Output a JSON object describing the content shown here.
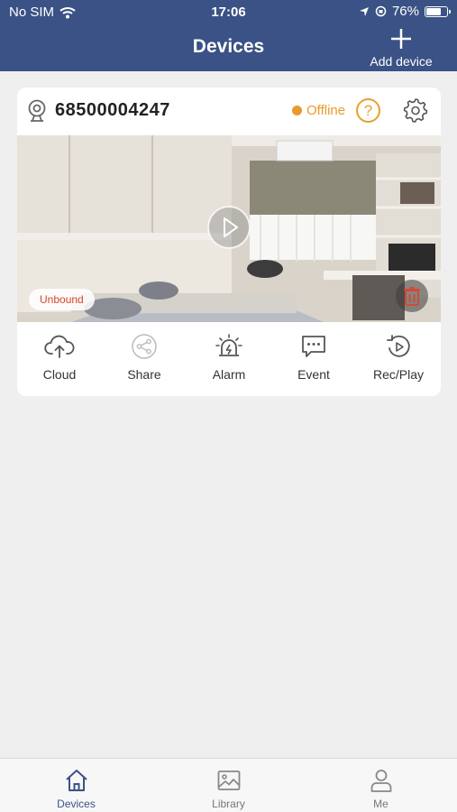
{
  "status_bar": {
    "carrier": "No SIM",
    "time": "17:06",
    "battery": "76%",
    "battery_level": 0.76
  },
  "header": {
    "title": "Devices",
    "add_label": "Add device"
  },
  "device": {
    "id": "68500004247",
    "status": "Offline",
    "help_glyph": "?",
    "badge": "Unbound",
    "actions": [
      {
        "label": "Cloud",
        "icon": "cloud-upload-icon"
      },
      {
        "label": "Share",
        "icon": "share-icon"
      },
      {
        "label": "Alarm",
        "icon": "alarm-icon"
      },
      {
        "label": "Event",
        "icon": "event-icon"
      },
      {
        "label": "Rec/Play",
        "icon": "playback-icon"
      }
    ]
  },
  "tabs": [
    {
      "label": "Devices",
      "icon": "home-icon",
      "active": true
    },
    {
      "label": "Library",
      "icon": "image-icon",
      "active": false
    },
    {
      "label": "Me",
      "icon": "user-icon",
      "active": false
    }
  ],
  "colors": {
    "nav": "#3a5285",
    "offline": "#e89a2b",
    "unbound": "#d9442e",
    "active_tab": "#3a5285"
  }
}
